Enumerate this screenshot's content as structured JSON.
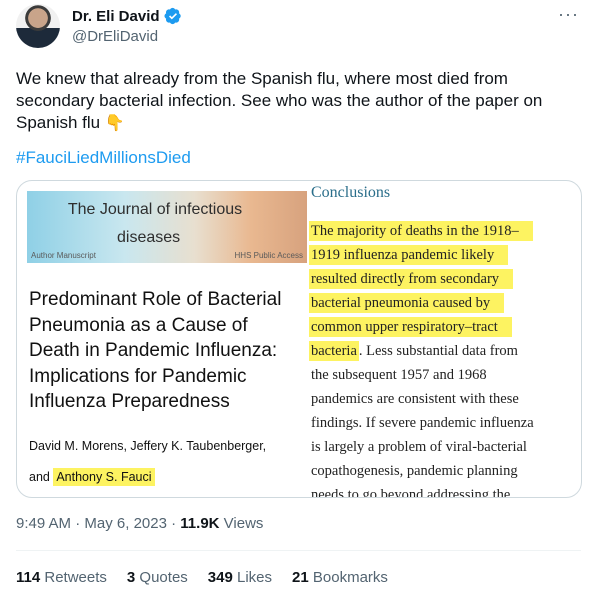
{
  "author": {
    "name": "Dr. Eli David",
    "handle": "@DrEliDavid"
  },
  "more_label": "···",
  "tweet": {
    "text": "We knew that already from the Spanish flu, where most died from secondary bacterial infection. See who was the author of the paper on Spanish flu",
    "emoji": "👇",
    "hashtag": "#FauciLiedMillionsDied"
  },
  "card": {
    "journal_title": "The Journal of infectious",
    "journal_subtitle": "diseases",
    "author_manuscript": "Author Manuscript",
    "public_access": "HHS Public Access",
    "paper_title": "Predominant Role of Bacterial Pneumonia as a Cause of Death in Pandemic Influenza: Implications for Pandemic Influenza Preparedness",
    "authors_line1": "David M. Morens, Jeffery K. Taubenberger,",
    "authors_and": "and",
    "authors_highlight": "Anthony S. Fauci",
    "conclusions_heading": "Conclusions",
    "conclusion_lines": [
      "The majority of deaths in the 1918–",
      "1919 influenza pandemic likely",
      "resulted directly from secondary",
      "bacterial pneumonia caused by",
      "common upper respiratory–tract",
      "bacteria",
      ". Less substantial data from",
      "the subsequent 1957 and 1968",
      "pandemics are consistent with these",
      "findings. If severe pandemic influenza",
      "is largely a problem of viral-bacterial",
      "copathogenesis, pandemic planning",
      "needs to go beyond addressing the"
    ],
    "highlight_color": "#fdf361"
  },
  "meta": {
    "time": "9:49 AM",
    "separator": "·",
    "date": "May 6, 2023",
    "views_count": "11.9K",
    "views_label": "Views"
  },
  "stats": {
    "retweets_count": "114",
    "retweets_label": "Retweets",
    "quotes_count": "3",
    "quotes_label": "Quotes",
    "likes_count": "349",
    "likes_label": "Likes",
    "bookmarks_count": "21",
    "bookmarks_label": "Bookmarks"
  },
  "colors": {
    "link": "#1d9bf0",
    "verified": "#1d9bf0",
    "muted_text": "#536471"
  }
}
